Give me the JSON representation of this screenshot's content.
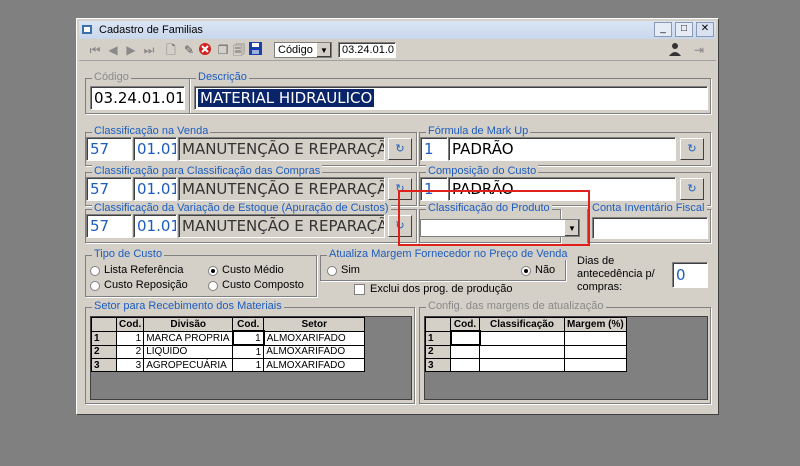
{
  "window": {
    "title": "Cadastro de Familias"
  },
  "toolbar": {
    "search_field": "Código",
    "search_value": "03.24.01.01"
  },
  "form": {
    "codigo": {
      "legend": "Código",
      "value": "03.24.01.01"
    },
    "descricao": {
      "legend": "Descrição",
      "value": "MATERIAL HIDRAULICO"
    },
    "class_venda": {
      "legend": "Classificação na Venda",
      "code": "57",
      "sub": "01.01",
      "text": "MANUTENÇÃO E REPARAÇÃ"
    },
    "formula_markup": {
      "legend": "Fórmula de Mark Up",
      "code": "1",
      "text": "PADRÃO"
    },
    "class_compras": {
      "legend": "Classificação para Classificação das Compras",
      "code": "57",
      "sub": "01.01",
      "text": "MANUTENÇÃO E REPARAÇÃ"
    },
    "composicao_custo": {
      "legend": "Composição do Custo",
      "code": "1",
      "text": "PADRÃO"
    },
    "class_estoque": {
      "legend": "Classificação da Variação de Estoque (Apuração de Custos)",
      "code": "57",
      "sub": "01.01",
      "text": "MANUTENÇÃO E REPARAÇÃ"
    },
    "class_produto": {
      "legend": "Classificação do Produto",
      "value": ""
    },
    "conta_inventario": {
      "legend": "Conta Inventário Fiscal",
      "value": ""
    },
    "tipo_custo": {
      "legend": "Tipo de Custo",
      "options": [
        "Lista Referência",
        "Custo Médio",
        "Custo Reposição",
        "Custo Composto"
      ],
      "selected": "Custo Médio"
    },
    "atualiza_margem": {
      "legend": "Atualiza Margem Fornecedor no Preço de Venda",
      "sim": "Sim",
      "nao": "Não",
      "selected": "Não"
    },
    "exclui_prog": {
      "label": "Exclui dos prog. de produção",
      "checked": false
    },
    "dias_antecedencia": {
      "label1": "Dias de",
      "label2": "antecedência p/",
      "label3": "compras:",
      "value": "0"
    }
  },
  "setor": {
    "legend": "Setor para Recebimento dos Materiais",
    "columns": [
      "Cod.",
      "Divisão",
      "Cod.",
      "Setor"
    ],
    "rows": [
      {
        "n": "1",
        "cod": "1",
        "divisao": "MARCA PROPRIA",
        "cod2": "1",
        "setor": "ALMOXARIFADO"
      },
      {
        "n": "2",
        "cod": "2",
        "divisao": "LIQUIDO",
        "cod2": "1",
        "setor": "ALMOXARIFADO"
      },
      {
        "n": "3",
        "cod": "3",
        "divisao": "AGROPECUÁRIA",
        "cod2": "1",
        "setor": "ALMOXARIFADO"
      }
    ]
  },
  "margens": {
    "legend": "Config. das margens de atualização",
    "columns": [
      "Cod.",
      "Classificação",
      "Margem (%)"
    ],
    "rows": [
      {
        "n": "1"
      },
      {
        "n": "2"
      },
      {
        "n": "3"
      }
    ]
  }
}
